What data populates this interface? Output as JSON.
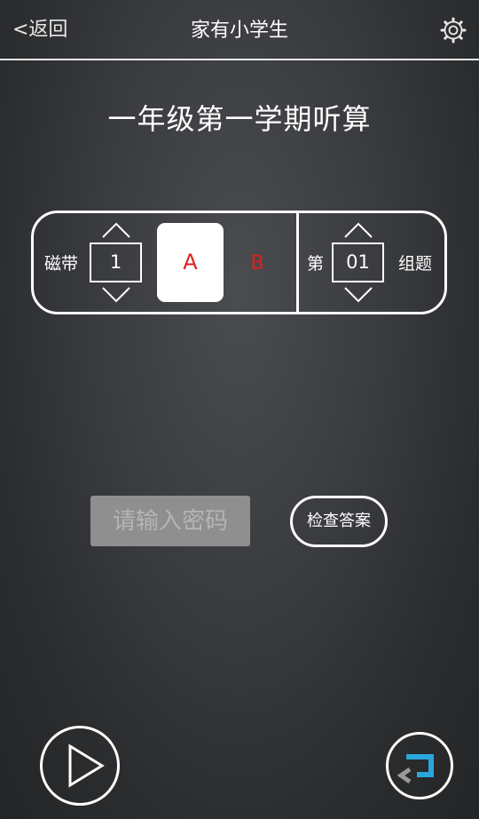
{
  "header": {
    "back_label": "<返回",
    "title": "家有小学生",
    "settings_icon": "gear-icon"
  },
  "main": {
    "title": "一年级第一学期听算"
  },
  "selector": {
    "tape_label": "磁带",
    "tape_value": "1",
    "side_a": "A",
    "side_b": "B",
    "group_prefix": "第",
    "group_value": "01",
    "group_suffix": "组题",
    "accent_color": "#dd1f1f"
  },
  "answer": {
    "password_placeholder": "请输入密码",
    "check_label": "检查答案"
  },
  "controls": {
    "play_icon": "play-icon",
    "return_icon": "return-icon",
    "return_color": "#2aa6dc"
  }
}
